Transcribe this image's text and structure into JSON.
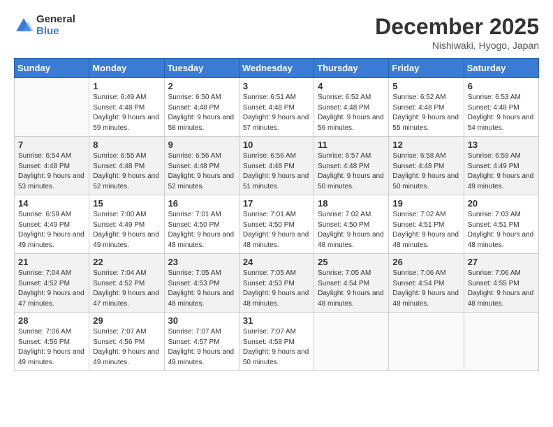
{
  "logo": {
    "general": "General",
    "blue": "Blue"
  },
  "title": "December 2025",
  "location": "Nishiwaki, Hyogo, Japan",
  "days_of_week": [
    "Sunday",
    "Monday",
    "Tuesday",
    "Wednesday",
    "Thursday",
    "Friday",
    "Saturday"
  ],
  "weeks": [
    [
      {
        "day": "",
        "sunrise": "",
        "sunset": "",
        "daylight": "",
        "empty": true
      },
      {
        "day": "1",
        "sunrise": "Sunrise: 6:49 AM",
        "sunset": "Sunset: 4:48 PM",
        "daylight": "Daylight: 9 hours and 59 minutes."
      },
      {
        "day": "2",
        "sunrise": "Sunrise: 6:50 AM",
        "sunset": "Sunset: 4:48 PM",
        "daylight": "Daylight: 9 hours and 58 minutes."
      },
      {
        "day": "3",
        "sunrise": "Sunrise: 6:51 AM",
        "sunset": "Sunset: 4:48 PM",
        "daylight": "Daylight: 9 hours and 57 minutes."
      },
      {
        "day": "4",
        "sunrise": "Sunrise: 6:52 AM",
        "sunset": "Sunset: 4:48 PM",
        "daylight": "Daylight: 9 hours and 56 minutes."
      },
      {
        "day": "5",
        "sunrise": "Sunrise: 6:52 AM",
        "sunset": "Sunset: 4:48 PM",
        "daylight": "Daylight: 9 hours and 55 minutes."
      },
      {
        "day": "6",
        "sunrise": "Sunrise: 6:53 AM",
        "sunset": "Sunset: 4:48 PM",
        "daylight": "Daylight: 9 hours and 54 minutes."
      }
    ],
    [
      {
        "day": "7",
        "sunrise": "Sunrise: 6:54 AM",
        "sunset": "Sunset: 4:48 PM",
        "daylight": "Daylight: 9 hours and 53 minutes."
      },
      {
        "day": "8",
        "sunrise": "Sunrise: 6:55 AM",
        "sunset": "Sunset: 4:48 PM",
        "daylight": "Daylight: 9 hours and 52 minutes."
      },
      {
        "day": "9",
        "sunrise": "Sunrise: 6:56 AM",
        "sunset": "Sunset: 4:48 PM",
        "daylight": "Daylight: 9 hours and 52 minutes."
      },
      {
        "day": "10",
        "sunrise": "Sunrise: 6:56 AM",
        "sunset": "Sunset: 4:48 PM",
        "daylight": "Daylight: 9 hours and 51 minutes."
      },
      {
        "day": "11",
        "sunrise": "Sunrise: 6:57 AM",
        "sunset": "Sunset: 4:48 PM",
        "daylight": "Daylight: 9 hours and 50 minutes."
      },
      {
        "day": "12",
        "sunrise": "Sunrise: 6:58 AM",
        "sunset": "Sunset: 4:48 PM",
        "daylight": "Daylight: 9 hours and 50 minutes."
      },
      {
        "day": "13",
        "sunrise": "Sunrise: 6:59 AM",
        "sunset": "Sunset: 4:49 PM",
        "daylight": "Daylight: 9 hours and 49 minutes."
      }
    ],
    [
      {
        "day": "14",
        "sunrise": "Sunrise: 6:59 AM",
        "sunset": "Sunset: 4:49 PM",
        "daylight": "Daylight: 9 hours and 49 minutes."
      },
      {
        "day": "15",
        "sunrise": "Sunrise: 7:00 AM",
        "sunset": "Sunset: 4:49 PM",
        "daylight": "Daylight: 9 hours and 49 minutes."
      },
      {
        "day": "16",
        "sunrise": "Sunrise: 7:01 AM",
        "sunset": "Sunset: 4:50 PM",
        "daylight": "Daylight: 9 hours and 48 minutes."
      },
      {
        "day": "17",
        "sunrise": "Sunrise: 7:01 AM",
        "sunset": "Sunset: 4:50 PM",
        "daylight": "Daylight: 9 hours and 48 minutes."
      },
      {
        "day": "18",
        "sunrise": "Sunrise: 7:02 AM",
        "sunset": "Sunset: 4:50 PM",
        "daylight": "Daylight: 9 hours and 48 minutes."
      },
      {
        "day": "19",
        "sunrise": "Sunrise: 7:02 AM",
        "sunset": "Sunset: 4:51 PM",
        "daylight": "Daylight: 9 hours and 48 minutes."
      },
      {
        "day": "20",
        "sunrise": "Sunrise: 7:03 AM",
        "sunset": "Sunset: 4:51 PM",
        "daylight": "Daylight: 9 hours and 48 minutes."
      }
    ],
    [
      {
        "day": "21",
        "sunrise": "Sunrise: 7:04 AM",
        "sunset": "Sunset: 4:52 PM",
        "daylight": "Daylight: 9 hours and 47 minutes."
      },
      {
        "day": "22",
        "sunrise": "Sunrise: 7:04 AM",
        "sunset": "Sunset: 4:52 PM",
        "daylight": "Daylight: 9 hours and 47 minutes."
      },
      {
        "day": "23",
        "sunrise": "Sunrise: 7:05 AM",
        "sunset": "Sunset: 4:53 PM",
        "daylight": "Daylight: 9 hours and 48 minutes."
      },
      {
        "day": "24",
        "sunrise": "Sunrise: 7:05 AM",
        "sunset": "Sunset: 4:53 PM",
        "daylight": "Daylight: 9 hours and 48 minutes."
      },
      {
        "day": "25",
        "sunrise": "Sunrise: 7:05 AM",
        "sunset": "Sunset: 4:54 PM",
        "daylight": "Daylight: 9 hours and 48 minutes."
      },
      {
        "day": "26",
        "sunrise": "Sunrise: 7:06 AM",
        "sunset": "Sunset: 4:54 PM",
        "daylight": "Daylight: 9 hours and 48 minutes."
      },
      {
        "day": "27",
        "sunrise": "Sunrise: 7:06 AM",
        "sunset": "Sunset: 4:55 PM",
        "daylight": "Daylight: 9 hours and 48 minutes."
      }
    ],
    [
      {
        "day": "28",
        "sunrise": "Sunrise: 7:06 AM",
        "sunset": "Sunset: 4:56 PM",
        "daylight": "Daylight: 9 hours and 49 minutes."
      },
      {
        "day": "29",
        "sunrise": "Sunrise: 7:07 AM",
        "sunset": "Sunset: 4:56 PM",
        "daylight": "Daylight: 9 hours and 49 minutes."
      },
      {
        "day": "30",
        "sunrise": "Sunrise: 7:07 AM",
        "sunset": "Sunset: 4:57 PM",
        "daylight": "Daylight: 9 hours and 49 minutes."
      },
      {
        "day": "31",
        "sunrise": "Sunrise: 7:07 AM",
        "sunset": "Sunset: 4:58 PM",
        "daylight": "Daylight: 9 hours and 50 minutes."
      },
      {
        "day": "",
        "sunrise": "",
        "sunset": "",
        "daylight": "",
        "empty": true
      },
      {
        "day": "",
        "sunrise": "",
        "sunset": "",
        "daylight": "",
        "empty": true
      },
      {
        "day": "",
        "sunrise": "",
        "sunset": "",
        "daylight": "",
        "empty": true
      }
    ]
  ]
}
